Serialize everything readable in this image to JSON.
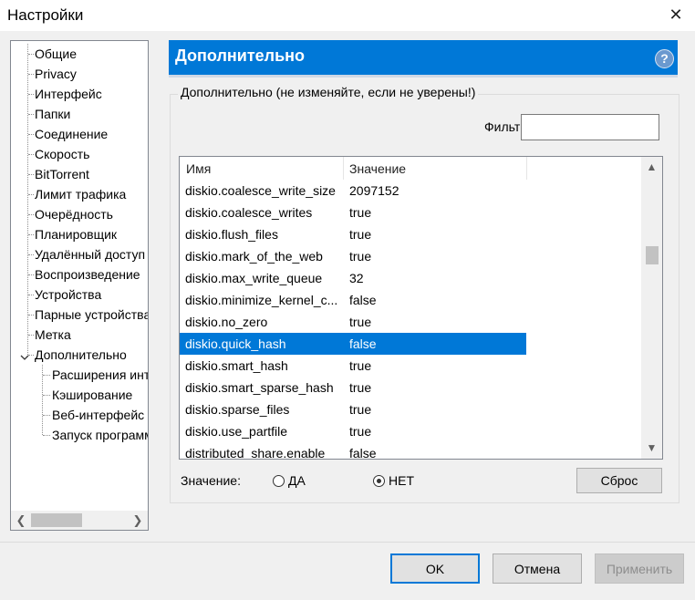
{
  "window": {
    "title": "Настройки",
    "close_glyph": "✕"
  },
  "sidebar": {
    "items": [
      {
        "label": "Общие"
      },
      {
        "label": "Privacy"
      },
      {
        "label": "Интерфейс"
      },
      {
        "label": "Папки"
      },
      {
        "label": "Соединение"
      },
      {
        "label": "Скорость"
      },
      {
        "label": "BitTorrent"
      },
      {
        "label": "Лимит трафика"
      },
      {
        "label": "Очерёдность"
      },
      {
        "label": "Планировщик"
      },
      {
        "label": "Удалённый доступ"
      },
      {
        "label": "Воспроизведение"
      },
      {
        "label": "Устройства"
      },
      {
        "label": "Парные устройства"
      },
      {
        "label": "Метка"
      },
      {
        "label": "Дополнительно"
      }
    ],
    "children": [
      {
        "label": "Расширения интерфейса"
      },
      {
        "label": "Кэширование"
      },
      {
        "label": "Веб-интерфейс"
      },
      {
        "label": "Запуск программ"
      }
    ]
  },
  "header": {
    "title": "Дополнительно",
    "help_glyph": "?"
  },
  "group": {
    "legend": "Дополнительно (не изменяйте, если не уверены!)",
    "filter_label": "Фильтр",
    "filter_value": ""
  },
  "table": {
    "columns": [
      "Имя",
      "Значение"
    ],
    "rows": [
      {
        "name": "diskio.coalesce_write_size",
        "value": "2097152"
      },
      {
        "name": "diskio.coalesce_writes",
        "value": "true"
      },
      {
        "name": "diskio.flush_files",
        "value": "true"
      },
      {
        "name": "diskio.mark_of_the_web",
        "value": "true"
      },
      {
        "name": "diskio.max_write_queue",
        "value": "32"
      },
      {
        "name": "diskio.minimize_kernel_c...",
        "value": "false"
      },
      {
        "name": "diskio.no_zero",
        "value": "true"
      },
      {
        "name": "diskio.quick_hash",
        "value": "false",
        "selected": true
      },
      {
        "name": "diskio.smart_hash",
        "value": "true"
      },
      {
        "name": "diskio.smart_sparse_hash",
        "value": "true"
      },
      {
        "name": "diskio.sparse_files",
        "value": "true"
      },
      {
        "name": "diskio.use_partfile",
        "value": "true"
      },
      {
        "name": "distributed_share.enable",
        "value": "false"
      }
    ]
  },
  "value_editor": {
    "label": "Значение:",
    "yes_label": "ДА",
    "no_label": "НЕТ",
    "selected": "no",
    "reset_label": "Сброс"
  },
  "footer": {
    "ok_label": "OK",
    "cancel_label": "Отмена",
    "apply_label": "Применить"
  },
  "colors": {
    "accent": "#0078d7",
    "selection": "#0078d7"
  }
}
